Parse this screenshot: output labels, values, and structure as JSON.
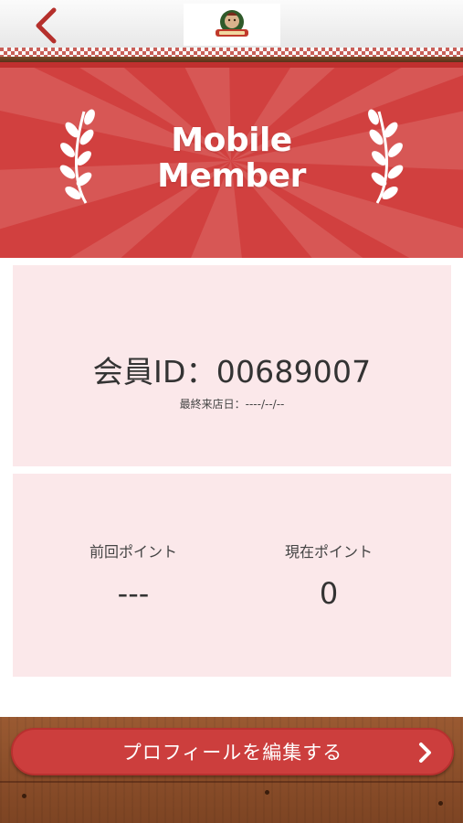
{
  "banner": {
    "title_line1": "Mobile",
    "title_line2": "Member"
  },
  "member": {
    "id_label": "会員ID：",
    "id_value": "00689007",
    "last_visit_label": "最終来店日：",
    "last_visit_value": "----/--/--"
  },
  "points": {
    "previous_label": "前回ポイント",
    "previous_value": "---",
    "current_label": "現在ポイント",
    "current_value": "0"
  },
  "footer": {
    "edit_profile_label": "プロフィールを編集する"
  },
  "icons": {
    "back": "chevron-left-icon",
    "logo": "restaurant-logo-icon",
    "laurel": "laurel-wreath-icon",
    "forward": "chevron-right-icon"
  },
  "colors": {
    "brand_red": "#d1403f",
    "card_pink": "#fbe8ea",
    "wood": "#8a4f2b"
  }
}
